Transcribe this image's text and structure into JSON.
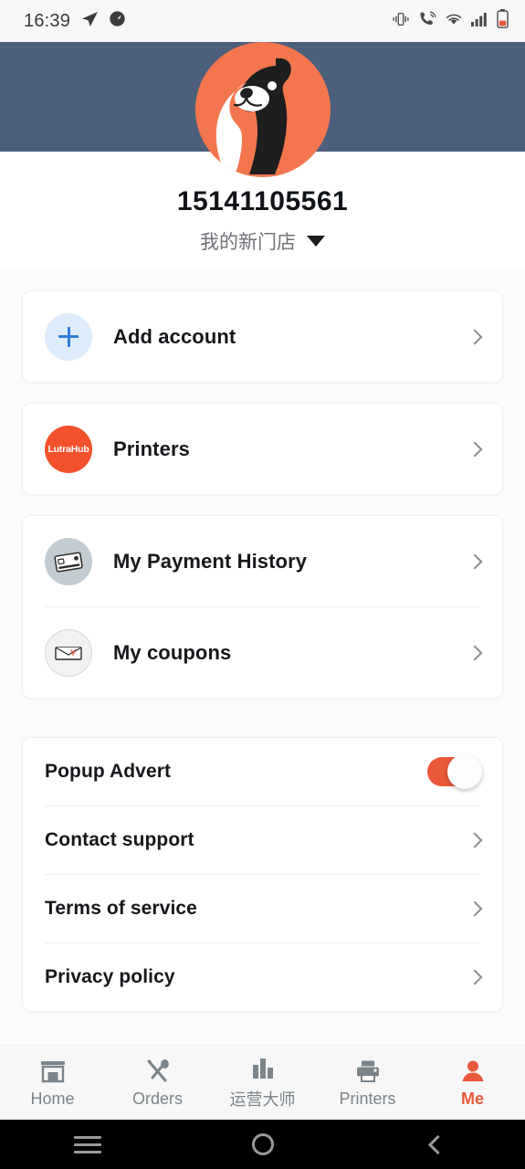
{
  "status_bar": {
    "time": "16:39",
    "left_icons": [
      "navigation-send-icon",
      "speedometer-icon"
    ],
    "right_icons": [
      "vibrate-icon",
      "call-wifi-icon",
      "wifi-icon",
      "signal-icon",
      "battery-low-icon"
    ]
  },
  "header": {
    "avatar_alt": "otter-mascot-avatar",
    "band_color": "#4C5F7B",
    "accent_color": "#F2512C"
  },
  "profile": {
    "phone_number": "15141105561",
    "store_name": "我的新门店",
    "store_dropdown_icon": "caret-down-icon"
  },
  "account_card": {
    "rows": [
      {
        "label": "Add account",
        "icon": "plus-icon",
        "chevron": "chevron-right-icon"
      }
    ]
  },
  "printers_card": {
    "rows": [
      {
        "label": "Printers",
        "icon": "lutrahub-logo-icon",
        "icon_text": "LutraHub",
        "chevron": "chevron-right-icon"
      }
    ]
  },
  "wallet_card": {
    "rows": [
      {
        "label": "My Payment History",
        "icon": "credit-card-icon",
        "chevron": "chevron-right-icon"
      },
      {
        "label": "My coupons",
        "icon": "coupon-icon",
        "chevron": "chevron-right-icon"
      }
    ]
  },
  "settings_card": {
    "rows": [
      {
        "label": "Popup Advert",
        "control": "toggle",
        "toggle_on": true
      },
      {
        "label": "Contact support",
        "control": "chevron",
        "chevron": "chevron-right-icon"
      },
      {
        "label": "Terms of service",
        "control": "chevron",
        "chevron": "chevron-right-icon"
      },
      {
        "label": "Privacy policy",
        "control": "chevron",
        "chevron": "chevron-right-icon"
      }
    ]
  },
  "tabbar": {
    "active_color": "#E8593A",
    "inactive_color": "#7B8489",
    "tabs": [
      {
        "label": "Home",
        "icon": "storefront-icon",
        "active": false
      },
      {
        "label": "Orders",
        "icon": "fork-spoon-icon",
        "active": false
      },
      {
        "label": "运营大师",
        "icon": "bar-chart-icon",
        "active": false
      },
      {
        "label": "Printers",
        "icon": "printer-icon",
        "active": false
      },
      {
        "label": "Me",
        "icon": "person-icon",
        "active": true
      }
    ]
  },
  "android_nav": {
    "buttons": [
      {
        "icon": "recents-icon"
      },
      {
        "icon": "home-circle-icon"
      },
      {
        "icon": "back-chevron-icon"
      }
    ]
  }
}
